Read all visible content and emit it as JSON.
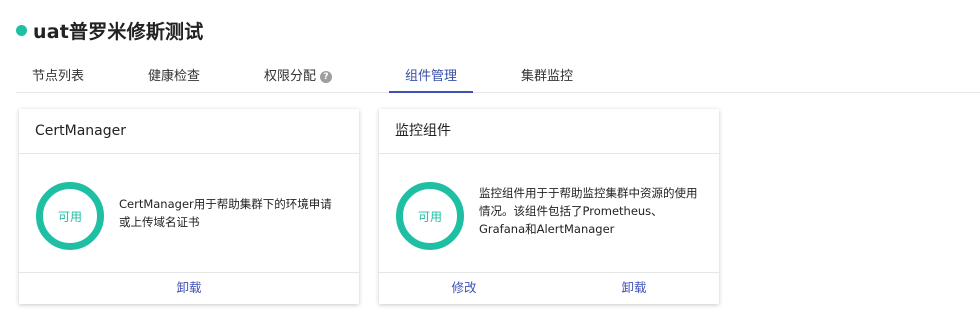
{
  "header": {
    "title": "uat普罗米修斯测试",
    "status_color": "#1fbfa4"
  },
  "tabs": [
    {
      "label": "节点列表",
      "active": false
    },
    {
      "label": "健康检查",
      "active": false
    },
    {
      "label": "权限分配",
      "active": false,
      "icon": "help-icon",
      "icon_glyph": "?"
    },
    {
      "label": "组件管理",
      "active": true
    },
    {
      "label": "集群监控",
      "active": false
    }
  ],
  "cards": [
    {
      "title": "CertManager",
      "status": "可用",
      "description": "CertManager用于帮助集群下的环境申请或上传域名证书",
      "actions": [
        "卸载"
      ]
    },
    {
      "title": "监控组件",
      "status": "可用",
      "description": "监控组件用于于帮助监控集群中资源的使用情况。该组件包括了Prometheus、Grafana和AlertManager",
      "actions": [
        "修改",
        "卸载"
      ]
    }
  ],
  "colors": {
    "accent": "#3f51b5",
    "available": "#1fbfa4"
  }
}
